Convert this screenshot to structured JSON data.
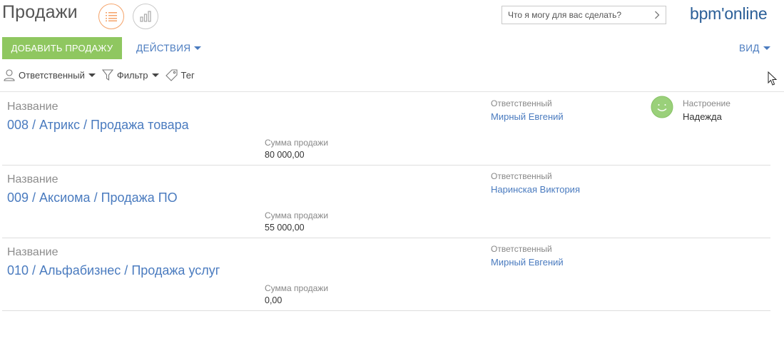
{
  "header": {
    "title": "Продажи",
    "search_placeholder": "Что я могу для вас сделать?",
    "brand": "bpm'online"
  },
  "toolbar": {
    "add_label": "ДОБАВИТЬ ПРОДАЖУ",
    "actions_label": "ДЕЙСТВИЯ",
    "view_label": "ВИД"
  },
  "filters": {
    "owner_label": "Ответственный",
    "filter_label": "Фильтр",
    "tag_label": "Тег"
  },
  "colors": {
    "accent": "#4a7bbf",
    "add_button": "#8fc760",
    "brand": "#2b5f98",
    "active_view": "#f5a36a",
    "mood_icon": "#9ad07a"
  },
  "records": [
    {
      "caption": "Название",
      "title": "008 / Атрикс / Продажа товара",
      "sum_label": "Сумма продажи",
      "sum_value": "80 000,00",
      "owner_label": "Ответственный",
      "owner_value": "Мирный Евгений",
      "mood_label": "Настроение",
      "mood_value": "Надежда",
      "mood_icon": "smiley-icon"
    },
    {
      "caption": "Название",
      "title": "009 / Аксиома / Продажа ПО",
      "sum_label": "Сумма продажи",
      "sum_value": "55 000,00",
      "owner_label": "Ответственный",
      "owner_value": "Наринская Виктория"
    },
    {
      "caption": "Название",
      "title": "010 / Альфабизнес / Продажа услуг",
      "sum_label": "Сумма продажи",
      "sum_value": "0,00",
      "owner_label": "Ответственный",
      "owner_value": "Мирный Евгений"
    }
  ]
}
